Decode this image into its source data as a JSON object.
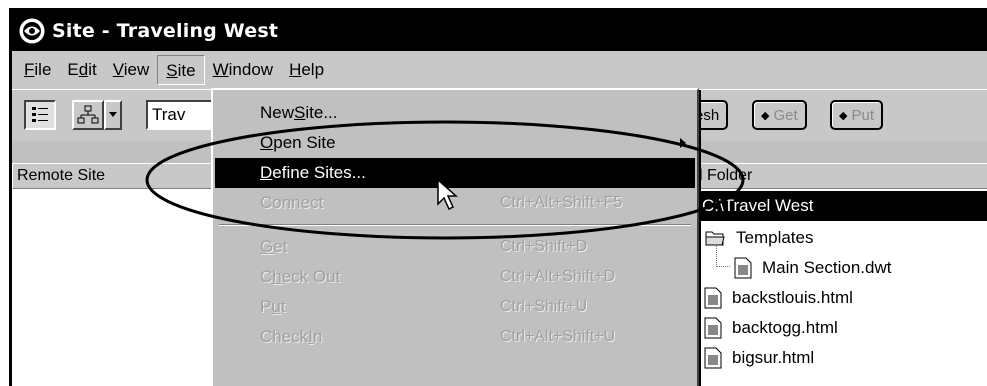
{
  "window": {
    "title": "Site - Traveling West"
  },
  "menubar": {
    "items": [
      {
        "label": "File",
        "ul": "F",
        "rest": "ile"
      },
      {
        "label": "Edit",
        "pre": "E",
        "ul": "d",
        "rest": "it"
      },
      {
        "label": "View",
        "ul": "V",
        "rest": "iew"
      },
      {
        "label": "Site",
        "ul": "S",
        "rest": "ite"
      },
      {
        "label": "Window",
        "ul": "W",
        "rest": "indow"
      },
      {
        "label": "Help",
        "ul": "H",
        "rest": "elp"
      }
    ]
  },
  "toolbar": {
    "site_select_value": "Trav",
    "refresh_label": "esh",
    "get_label": "Get",
    "put_label": "Put"
  },
  "panes": {
    "remote_header": "Remote Site",
    "local_header": "l Folder"
  },
  "site_menu": {
    "items": [
      {
        "pre": "New ",
        "ul": "S",
        "rest": "ite...",
        "shortcut": "",
        "state": "normal"
      },
      {
        "pre": "",
        "ul": "O",
        "rest": "pen Site",
        "shortcut": "",
        "state": "normal",
        "submenu": true
      },
      {
        "pre": "",
        "ul": "D",
        "rest": "efine Sites...",
        "shortcut": "",
        "state": "highlight"
      },
      {
        "pre": "",
        "ul": "",
        "rest": "Connect",
        "shortcut": "Ctrl+Alt+Shift+F5",
        "state": "disabled"
      },
      {
        "pre": "",
        "ul": "G",
        "rest": "et",
        "shortcut": "Ctrl+Shift+D",
        "state": "disabled"
      },
      {
        "pre": "C",
        "ul": "h",
        "rest": "eck Out",
        "shortcut": "Ctrl+Alt+Shift+D",
        "state": "disabled"
      },
      {
        "pre": "P",
        "ul": "u",
        "rest": "t",
        "shortcut": "Ctrl+Shift+U",
        "state": "disabled"
      },
      {
        "pre": "Check ",
        "ul": "I",
        "rest": "n",
        "shortcut": "Ctrl+Alt+Shift+U",
        "state": "disabled"
      }
    ]
  },
  "local_files": {
    "root": "C:\\Travel West",
    "folder": "Templates",
    "template_file": "Main Section.dwt",
    "files": [
      "backstlouis.html",
      "backtogg.html",
      "bigsur.html"
    ]
  },
  "colors": {
    "highlight": "#000000",
    "menu_bg": "#c0c0c0",
    "disabled_text": "#a0a0a0"
  }
}
